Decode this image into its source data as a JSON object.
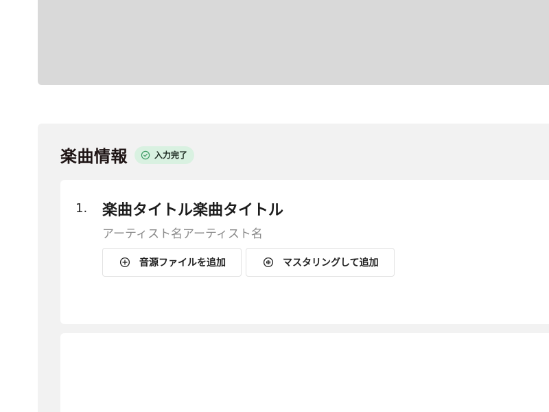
{
  "section": {
    "title": "楽曲情報",
    "status_badge": {
      "label": "入力完了",
      "icon": "check-circle-icon",
      "color": "#d9f1e1"
    }
  },
  "tracks": [
    {
      "number": "1.",
      "title": "楽曲タイトル楽曲タイトル",
      "artist": "アーティスト名アーティスト名",
      "actions": [
        {
          "label": "音源ファイルを追加",
          "icon": "plus-circle-icon"
        },
        {
          "label": "マスタリングして追加",
          "icon": "waveform-circle-icon"
        }
      ]
    }
  ],
  "colors": {
    "placeholder_gray": "#d9d9d9",
    "section_bg": "#f2f2f2",
    "badge_bg": "#d9f1e1",
    "badge_icon": "#3a9a62"
  }
}
